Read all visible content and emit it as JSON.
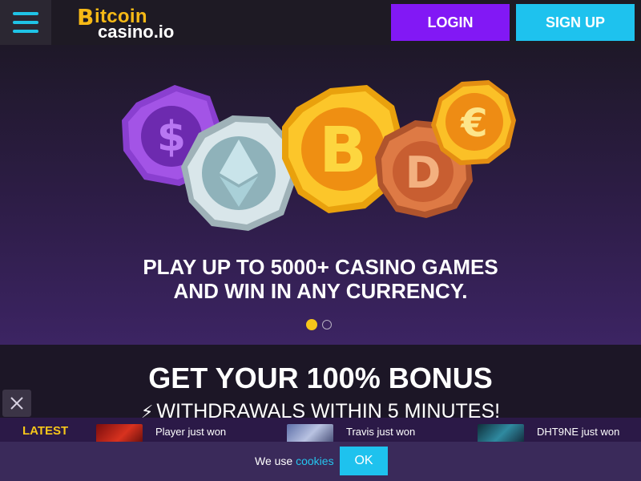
{
  "header": {
    "menu_icon": "hamburger-menu-icon",
    "logo": {
      "b": "B",
      "line1": "itcoin",
      "line2": "casino.io"
    },
    "login_label": "LOGIN",
    "signup_label": "SIGN UP"
  },
  "hero": {
    "line1": "PLAY UP TO 5000+ CASINO GAMES",
    "line2": "AND WIN IN ANY CURRENCY.",
    "coins": [
      "dollar-coin",
      "ethereum-coin",
      "bitcoin-coin",
      "dogecoin-coin",
      "euro-coin"
    ],
    "slides": {
      "active": 1,
      "total": 2
    }
  },
  "bonus": {
    "title": "GET YOUR 100% BONUS",
    "subtitle": "WITHDRAWALS WITHIN 5 MINUTES!",
    "subtitle_icon": "lightning-icon"
  },
  "latest": {
    "label": "LATEST",
    "wins": [
      {
        "text": "Player just won"
      },
      {
        "text": "Travis just won"
      },
      {
        "text": "DHT9NE just won"
      }
    ]
  },
  "cookie": {
    "prefix": "We use ",
    "link": "cookies",
    "ok_label": "OK"
  },
  "colors": {
    "accent_purple": "#8218f5",
    "accent_cyan": "#1ec2ee",
    "gold": "#f6c61a"
  }
}
